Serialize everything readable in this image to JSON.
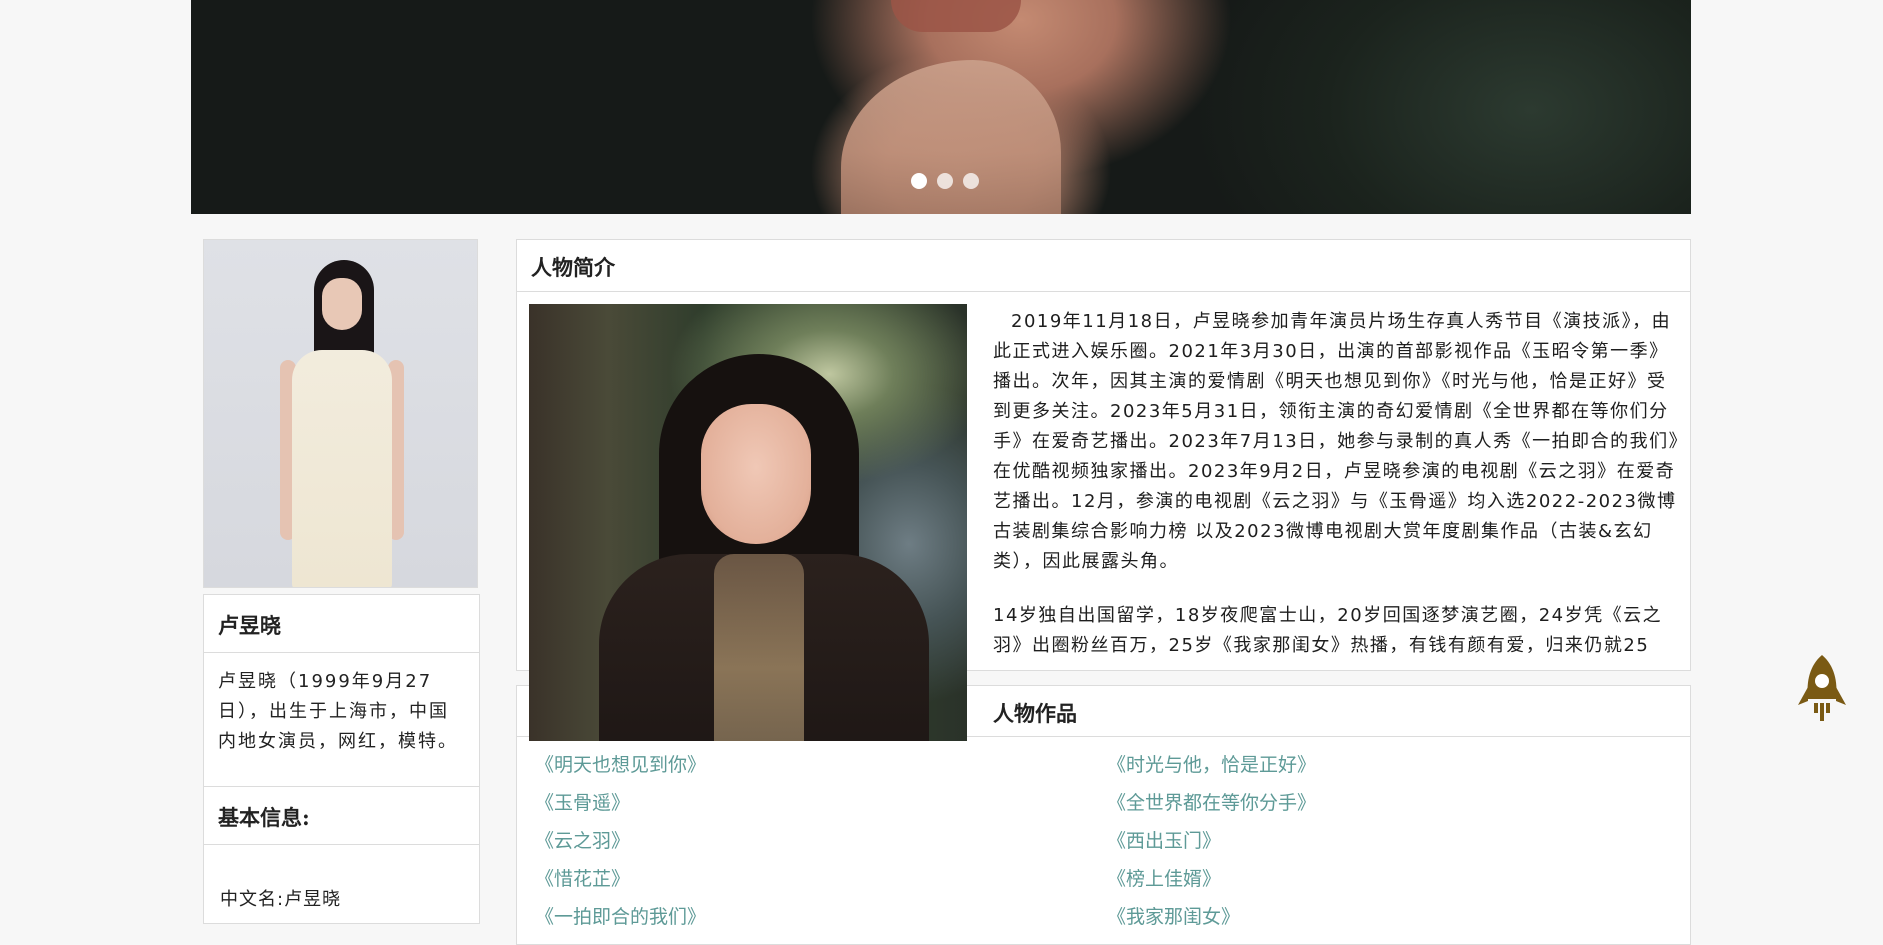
{
  "banner": {
    "slides": [
      "slide-1",
      "slide-2",
      "slide-3"
    ],
    "active_slide": 1
  },
  "profile": {
    "name": "卢昱晓",
    "intro": "卢昱晓（1999年9月27日），出生于上海市，中国内地女演员，网红，模特。",
    "basic_info_title": "基本信息:",
    "chinese_name": "中文名:卢昱晓"
  },
  "bio": {
    "title": "人物简介",
    "paragraph_1": "2019年11月18日，卢昱晓参加青年演员片场生存真人秀节目《演技派》，由此正式进入娱乐圈。2021年3月30日，出演的首部影视作品《玉昭令第一季》播出。次年，因其主演的爱情剧《明天也想见到你》《时光与他，恰是正好》受到更多关注。2023年5月31日，领衔主演的奇幻爱情剧《全世界都在等你们分手》在爱奇艺播出。2023年7月13日，她参与录制的真人秀《一拍即合的我们》在优酷视频独家播出。2023年9月2日，卢昱晓参演的电视剧《云之羽》在爱奇艺播出。12月，参演的电视剧《云之羽》与《玉骨遥》均入选2022-2023微博古装剧集综合影响力榜 以及2023微博电视剧大赏年度剧集作品（古装&玄幻类），因此展露头角。",
    "paragraph_2": "14岁独自出国留学，18岁夜爬富士山，20岁回国逐梦演艺圈，24岁凭《云之羽》出圈粉丝百万，25岁《我家那闺女》热播，有钱有颜有爱，归来仍就25"
  },
  "works": {
    "title": "人物作品",
    "items": [
      "《明天也想见到你》",
      "《时光与他，恰是正好》",
      "《玉骨遥》",
      "《全世界都在等你分手》",
      "《云之羽》",
      "《西出玉门》",
      "《惜花芷》",
      "《榜上佳婿》",
      "《一拍即合的我们》",
      "《我家那闺女》"
    ]
  },
  "icons": {
    "back_to_top": "rocket-icon"
  },
  "colors": {
    "link": "#5e9a97",
    "rocket": "#7a5a14",
    "border": "#dcdcdc"
  }
}
